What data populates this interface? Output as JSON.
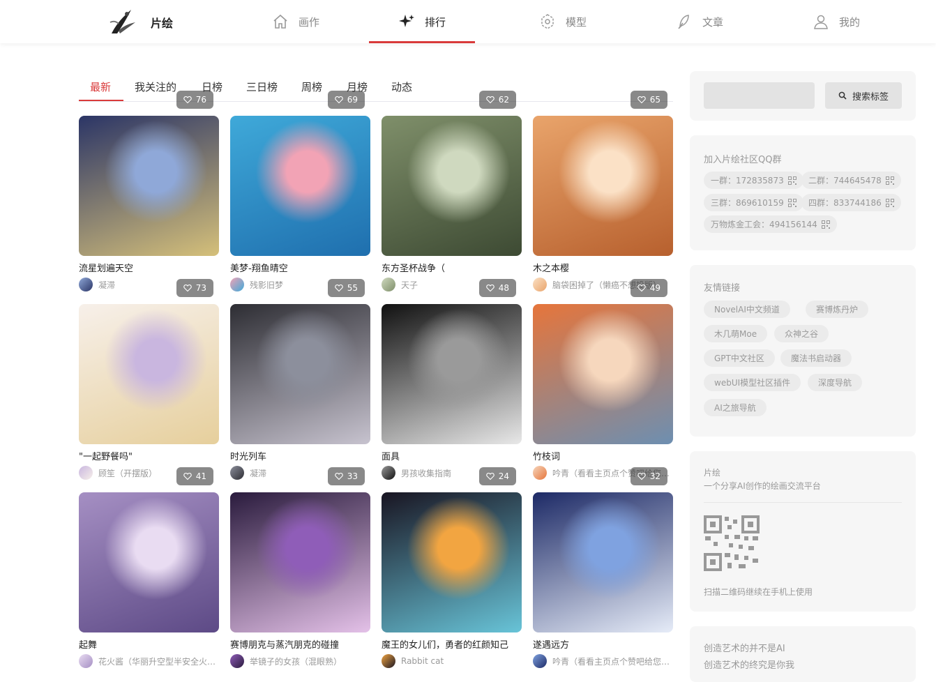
{
  "header": {
    "brand": "片绘",
    "nav": [
      {
        "label": "画作",
        "icon": "home-icon"
      },
      {
        "label": "排行",
        "icon": "sparkle-icon"
      },
      {
        "label": "模型",
        "icon": "model-icon"
      },
      {
        "label": "文章",
        "icon": "article-icon"
      },
      {
        "label": "我的",
        "icon": "user-icon"
      }
    ],
    "active_nav": "排行"
  },
  "tabs": [
    {
      "label": "最新"
    },
    {
      "label": "我关注的"
    },
    {
      "label": "日榜"
    },
    {
      "label": "三日榜"
    },
    {
      "label": "周榜"
    },
    {
      "label": "月榜"
    },
    {
      "label": "动态"
    }
  ],
  "active_tab": "最新",
  "artworks": [
    {
      "title": "流星划遍天空",
      "author": "凝滞",
      "likes": "76",
      "colors": [
        "#2b3566",
        "#8fa8d8",
        "#d5c07a"
      ]
    },
    {
      "title": "美梦-翔鱼晴空",
      "author": "残影旧梦",
      "likes": "69",
      "colors": [
        "#3fa9d9",
        "#f2a3b5",
        "#1f6fae"
      ]
    },
    {
      "title": "东方圣杯战争（",
      "author": "天子",
      "likes": "62",
      "colors": [
        "#7f8f6a",
        "#cfd9bf",
        "#3d4a33"
      ]
    },
    {
      "title": "木之本樱",
      "author": "脑袋困掉了（懒癌不想投版）",
      "likes": "65",
      "colors": [
        "#e9a46b",
        "#fbe1c6",
        "#b7602e"
      ]
    },
    {
      "title": "\"一起野餐吗\"",
      "author": "顾笙（开摆版）",
      "likes": "73",
      "colors": [
        "#f7f0ea",
        "#c9b6df",
        "#e6cf9c"
      ]
    },
    {
      "title": "时光列车",
      "author": "凝滞",
      "likes": "55",
      "colors": [
        "#2d2d33",
        "#8c8f9c",
        "#c7c3cf"
      ]
    },
    {
      "title": "面具",
      "author": "男孩收集指南",
      "likes": "48",
      "colors": [
        "#111111",
        "#9a9a9a",
        "#e8e8e8"
      ]
    },
    {
      "title": "竹枝词",
      "author": "吟青（看看主页点个赞吧给您磕头了）",
      "likes": "49",
      "colors": [
        "#e6753b",
        "#f6d7bd",
        "#6d8fb1"
      ]
    },
    {
      "title": "起舞",
      "author": "花火酱（华丽升空型半安全火药）",
      "likes": "41",
      "colors": [
        "#a58fc3",
        "#e9dcf2",
        "#5d4a86"
      ]
    },
    {
      "title": "赛博朋克与蒸汽朋克的碰撞",
      "author": "举镜子的女孩（混眼熟）",
      "likes": "33",
      "colors": [
        "#2a1b3d",
        "#8f5db8",
        "#e4c1e8"
      ]
    },
    {
      "title": "魔王的女儿们，勇者的红颜知己",
      "author": "Rabbit cat",
      "likes": "24",
      "colors": [
        "#191522",
        "#f2a541",
        "#68c4d8"
      ]
    },
    {
      "title": "遂遇远方",
      "author": "吟青（看看主页点个赞吧给您磕头了）",
      "likes": "32",
      "colors": [
        "#1d2a66",
        "#7fa2e0",
        "#e6ecf8"
      ]
    }
  ],
  "sidebar": {
    "search_button": "搜索标签",
    "qq": {
      "title": "加入片绘社区QQ群",
      "groups": [
        "一群：172835873",
        "二群：744645478",
        "三群：869610159",
        "四群：833744186",
        "万物炼金工会：494156144"
      ]
    },
    "links": {
      "title": "友情链接",
      "items": [
        "NovelAI中文频道",
        "赛博炼丹炉",
        "木几萌Moe",
        "众神之谷",
        "GPT中文社区",
        "魔法书启动器",
        "webUI模型社区插件",
        "深度导航",
        "AI之旅导航"
      ]
    },
    "about": {
      "name": "片绘",
      "desc": "一个分享AI创作的绘画交流平台",
      "qr_hint": "扫描二维码继续在手机上使用"
    },
    "slogan": [
      "创造艺术的并不是AI",
      "创造艺术的终究是你我"
    ]
  },
  "colors": {
    "accent": "#d93a3a"
  }
}
